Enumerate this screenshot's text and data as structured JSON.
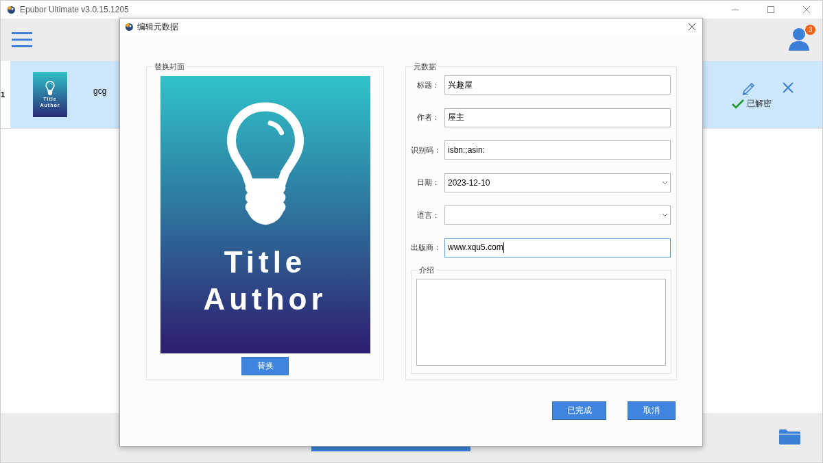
{
  "window": {
    "title": "Epubor Ultimate v3.0.15.1205"
  },
  "header": {
    "notification_count": "3"
  },
  "books": [
    {
      "index": "1",
      "cover": {
        "title": "Title",
        "author": "Author"
      },
      "name": "gcg",
      "status": "已解密",
      "selected": true
    }
  ],
  "dialog": {
    "title": "编辑元数据",
    "cover_group": {
      "legend": "替换封面",
      "cover": {
        "title": "Title",
        "author": "Author"
      },
      "button": "替换"
    },
    "metadata_group": {
      "legend": "元数据",
      "fields": [
        {
          "label": "标题：",
          "value": "兴趣屋",
          "kind": "text",
          "focused": false
        },
        {
          "label": "作者：",
          "value": "屋主",
          "kind": "text",
          "focused": false
        },
        {
          "label": "识别码：",
          "value": "isbn:;asin:",
          "kind": "text",
          "focused": false
        },
        {
          "label": "日期：",
          "value": "2023-12-10",
          "kind": "dropdown",
          "focused": false
        },
        {
          "label": "语言：",
          "kind": "dropdown",
          "focused": false
        },
        {
          "label": "出版商：",
          "value": "www.xqu5.com",
          "kind": "text",
          "focused": true
        }
      ],
      "intro": {
        "legend": "介绍"
      }
    },
    "buttons": [
      {
        "label": "已完成"
      },
      {
        "label": "取消"
      }
    ]
  }
}
